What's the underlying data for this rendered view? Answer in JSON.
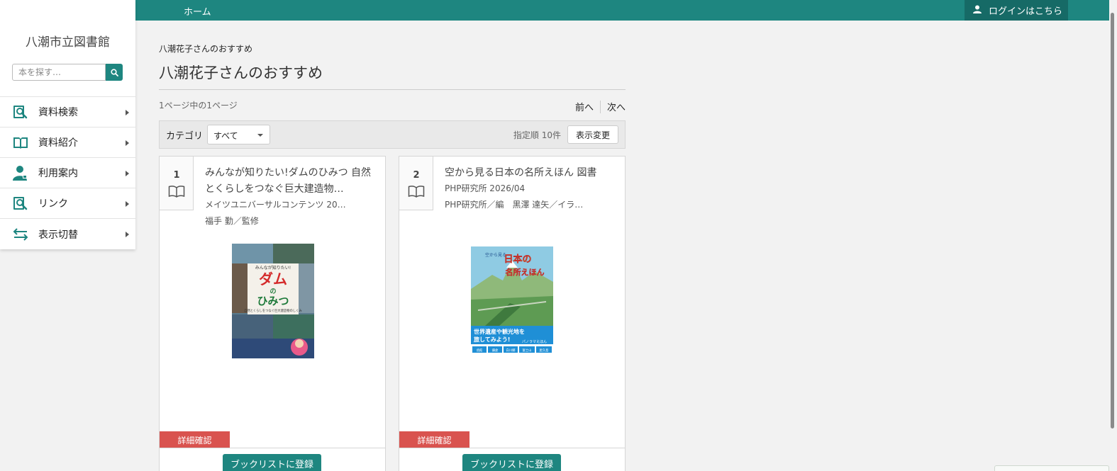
{
  "header": {
    "home_label": "ホーム",
    "login_label": "ログインはこちら"
  },
  "sidebar": {
    "library_name": "八潮市立図書館",
    "search_placeholder": "本を探す…",
    "items": [
      {
        "label": "資料検索",
        "icon": "book-search-icon"
      },
      {
        "label": "資料紹介",
        "icon": "open-book-icon"
      },
      {
        "label": "利用案内",
        "icon": "person-icon"
      },
      {
        "label": "リンク",
        "icon": "book-search-icon"
      },
      {
        "label": "表示切替",
        "icon": "swap-arrows-icon"
      }
    ]
  },
  "main": {
    "breadcrumb": "八潮花子さんのおすすめ",
    "title": "八潮花子さんのおすすめ",
    "page_info": "1ページ中の1ページ",
    "prev_label": "前へ",
    "next_label": "次へ",
    "category_label": "カテゴリ",
    "category_value": "すべて",
    "sort_info": "指定順 10件",
    "display_change_label": "表示変更"
  },
  "cards": [
    {
      "number": "1",
      "title": "みんなが知りたい!ダムのひみつ 自然とくらしをつなぐ巨大建造物…",
      "publisher": "メイツユニバーサルコンテンツ 20…",
      "author": "福手 勤／監修",
      "cover_top_text": "みんなが知りたい!",
      "cover_big_text": "ダム",
      "cover_no": "の",
      "cover_secret": "ひみつ",
      "cover_sub_text": "自然とくらしをつなぐ巨大建造物のしくみ",
      "detail_label": "詳細確認",
      "booklist_label": "ブックリストに登録"
    },
    {
      "number": "2",
      "title": "空から見る日本の名所えほん 図書",
      "publisher": "PHP研究所 2026/04",
      "author": "PHP研究所／編　黒澤 達矢／イラ…",
      "cover_top_text": "空から見る",
      "cover_big_text": "日本の",
      "cover_sub_text": "名所えほん",
      "cover_banner_1": "世界遺産や観光地を",
      "cover_banner_2": "旅してみよう!",
      "cover_banner_3": "パノラマえほん",
      "cover_tags": [
        "函館",
        "鎌倉",
        "白川郷",
        "富士山",
        "屋久島"
      ],
      "detail_label": "詳細確認",
      "booklist_label": "ブックリストに登録"
    }
  ],
  "colors": {
    "teal": "#1e8680",
    "teal_dark": "#166a66",
    "detail_red": "#d9534f"
  }
}
